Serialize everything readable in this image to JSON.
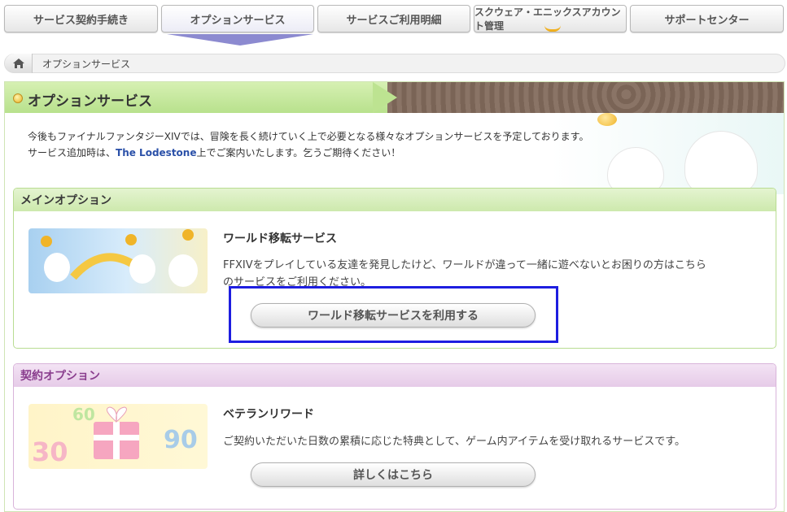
{
  "nav": {
    "tabs": [
      {
        "label": "サービス契約手続き"
      },
      {
        "label": "オプションサービス"
      },
      {
        "label": "サービスご利用明細"
      },
      {
        "label": "スクウェア・エニックスアカウント管理"
      },
      {
        "label": "サポートセンター"
      }
    ]
  },
  "breadcrumb": {
    "current": "オプションサービス"
  },
  "panel": {
    "title": "オプションサービス",
    "intro_line1": "今後もファイナルファンタジーXIVでは、冒険を長く続けていく上で必要となる様々なオプションサービスを予定しております。",
    "intro_line2_prefix": "サービス追加時は、",
    "intro_line2_link": "The Lodestone",
    "intro_line2_suffix": "上でご案内いたします。乞うご期待ください！"
  },
  "main_option": {
    "header": "メインオプション",
    "title": "ワールド移転サービス",
    "desc_line1": "FFXIVをプレイしている友達を発見したけど、ワールドが違って一緒に遊べないとお困りの方はこちら",
    "desc_line2": "のサービスをご利用ください。",
    "button": "ワールド移転サービスを利用する"
  },
  "contract_option": {
    "header": "契約オプション",
    "title": "ベテランリワード",
    "desc": "ご契約いただいた日数の累積に応じた特典として、ゲーム内アイテムを受け取れるサービスです。",
    "button": "詳しくはこちら",
    "thumb_numbers": [
      "60",
      "30",
      "90"
    ]
  },
  "colors": {
    "accent_green": "#b8e18d",
    "contract_purple": "#8a3e8e",
    "link_blue": "#2a50a8",
    "focus_box": "#1e1ee0"
  }
}
